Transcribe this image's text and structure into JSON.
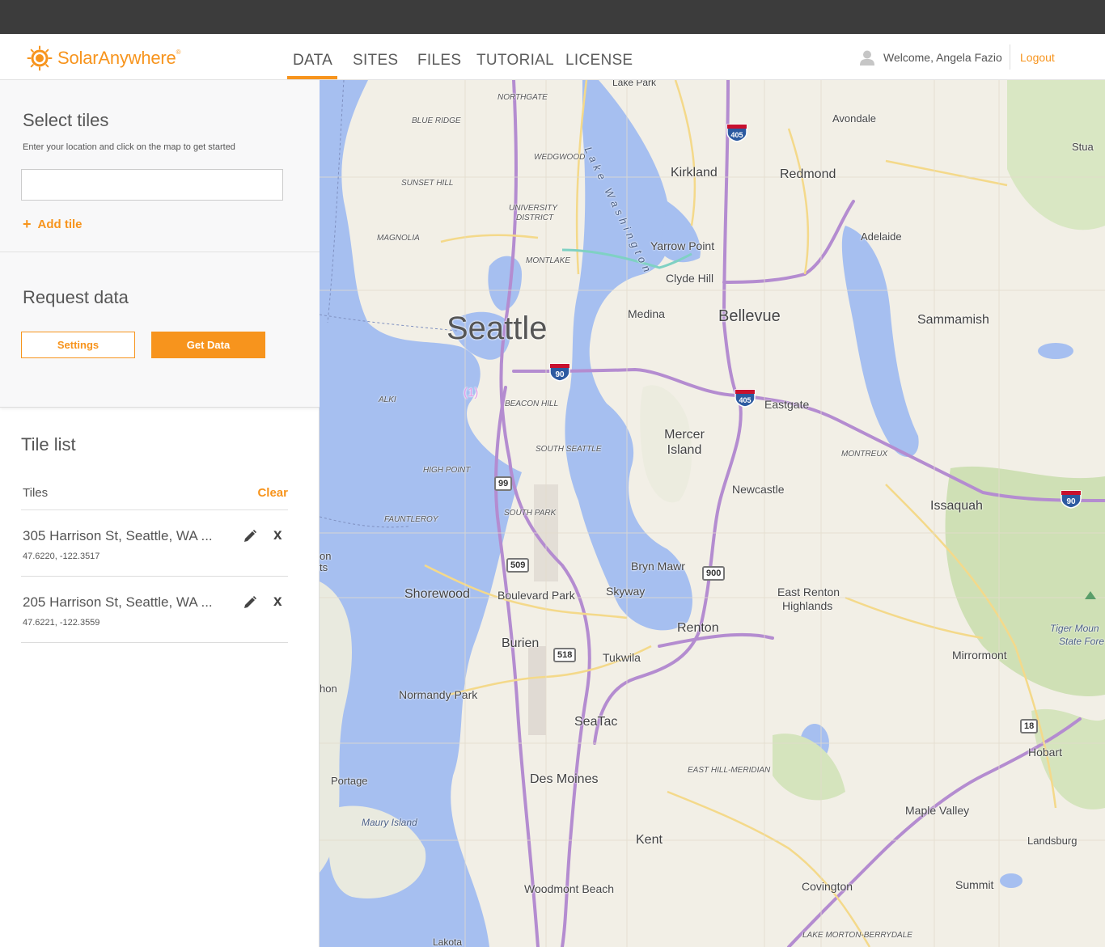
{
  "header": {
    "brand": "SolarAnywhere",
    "brand_mark": "®",
    "nav": [
      "DATA",
      "SITES",
      "FILES",
      "TUTORIAL",
      "LICENSE"
    ],
    "active_nav": "DATA",
    "welcome": "Welcome, Angela Fazio",
    "logout": "Logout",
    "accent_color": "#f7941d"
  },
  "select_tiles": {
    "title": "Select tiles",
    "hint": "Enter your location and click on the map to get started",
    "input_value": "",
    "add_tile": "Add tile"
  },
  "request_data": {
    "title": "Request data",
    "settings": "Settings",
    "get_data": "Get Data"
  },
  "tile_list": {
    "title": "Tile list",
    "tiles_label": "Tiles",
    "clear": "Clear",
    "items": [
      {
        "name": "305 Harrison St, Seattle, WA ...",
        "coords": "47.6220,  -122.3517"
      },
      {
        "name": "205 Harrison St, Seattle, WA ...",
        "coords": "47.6221,  -122.3559"
      }
    ]
  },
  "map": {
    "labels": {
      "seattle": "Seattle",
      "bellevue": "Bellevue",
      "redmond": "Redmond",
      "kirkland": "Kirkland",
      "mercer_island": "Mercer Island",
      "issaquah": "Issaquah",
      "renton": "Renton",
      "sammamish": "Sammamish",
      "newcastle": "Newcastle",
      "eastgate": "Eastgate",
      "medina": "Medina",
      "clyde_hill": "Clyde Hill",
      "yarrow_point": "Yarrow Point",
      "avondale": "Avondale",
      "adelaide": "Adelaide",
      "bryn_mawr": "Bryn Mawr",
      "skyway": "Skyway",
      "tukwila": "Tukwila",
      "burien": "Burien",
      "shorewood": "Shorewood",
      "boulevard_park": "Boulevard Park",
      "normandy_park": "Normandy Park",
      "seatac": "SeaTac",
      "des_moines": "Des Moines",
      "kent": "Kent",
      "woodmont_beach": "Woodmont Beach",
      "covington": "Covington",
      "summit": "Summit",
      "maple_valley": "Maple Valley",
      "hobart": "Hobart",
      "landsburg": "Landsburg",
      "mirrormont": "Mirrormont",
      "east_renton": "East Renton",
      "highlands": "Highlands",
      "tiger_mountain": "Tiger Moun",
      "state_forest": "State Fore",
      "portage": "Portage",
      "maury_island": "Maury Island",
      "lake_park": "Lake Park",
      "lake_washington": "Lake Washington",
      "northgate": "NORTHGATE",
      "blue_ridge": "BLUE RIDGE",
      "wedgwood": "WEDGWOOD",
      "sunset_hill": "SUNSET HILL",
      "university_district_1": "UNIVERSITY",
      "university_district_2": "DISTRICT",
      "magnolia": "MAGNOLIA",
      "montlake": "MONTLAKE",
      "beacon_hill": "BEACON HILL",
      "alki": "ALKI",
      "south_seattle": "SOUTH SEATTLE",
      "high_point": "HIGH POINT",
      "fauntleroy": "FAUNTLEROY",
      "south_park": "SOUTH PARK",
      "montreux": "MONTREUX",
      "east_hill_meridian": "EAST HILL-MERIDIAN",
      "lake_morton": "LAKE MORTON-BERRYDALE",
      "stuart": "Stua",
      "vashon": "hon",
      "edge_on": "on",
      "edge_ts": "ts",
      "lakota": "Lakota",
      "marker_1": "(1)"
    },
    "shields": {
      "i405_a": "405",
      "i405_b": "405",
      "i90_a": "90",
      "i90_b": "90",
      "sr99": "99",
      "sr509": "509",
      "sr518": "518",
      "sr900": "900",
      "sr18": "18"
    }
  }
}
